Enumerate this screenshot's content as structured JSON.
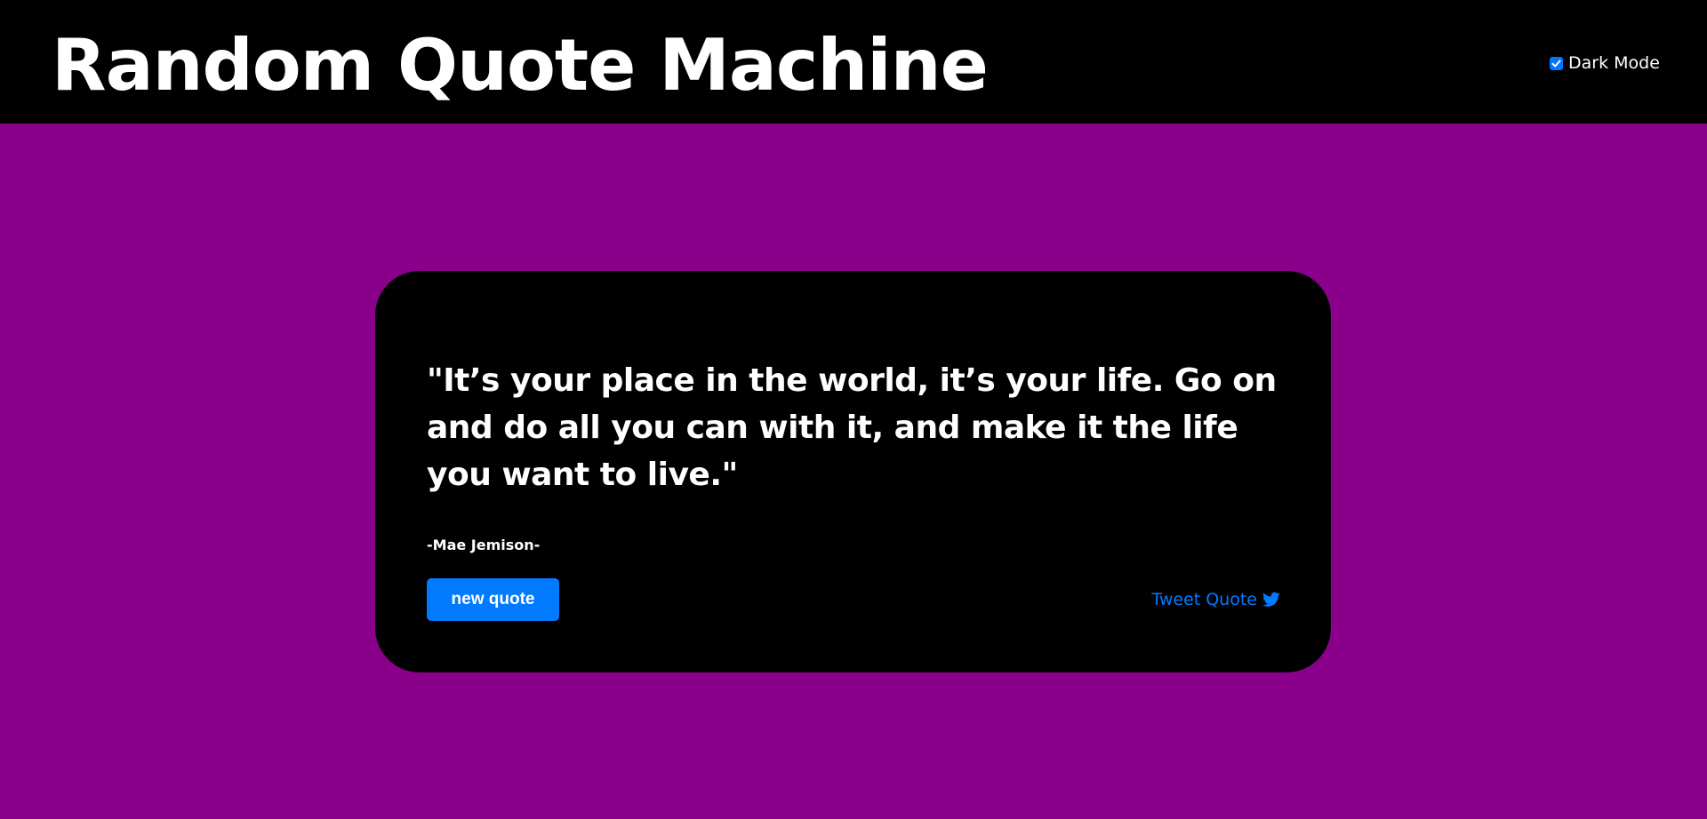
{
  "header": {
    "title": "Random Quote Machine",
    "dark_mode_label": "Dark Mode",
    "dark_mode_checked": true
  },
  "quote": {
    "text": "\"It’s your place in the world, it’s your life. Go on and do all you can with it, and make it the life you want to live.\"",
    "author": "-Mae Jemison-"
  },
  "actions": {
    "new_quote_label": "new quote",
    "tweet_label": "Tweet Quote",
    "tweet_icon": "twitter-icon"
  },
  "colors": {
    "page_background": "#8b008b",
    "header_background": "#000000",
    "card_background": "#000000",
    "accent": "#007bff",
    "text": "#ffffff"
  }
}
